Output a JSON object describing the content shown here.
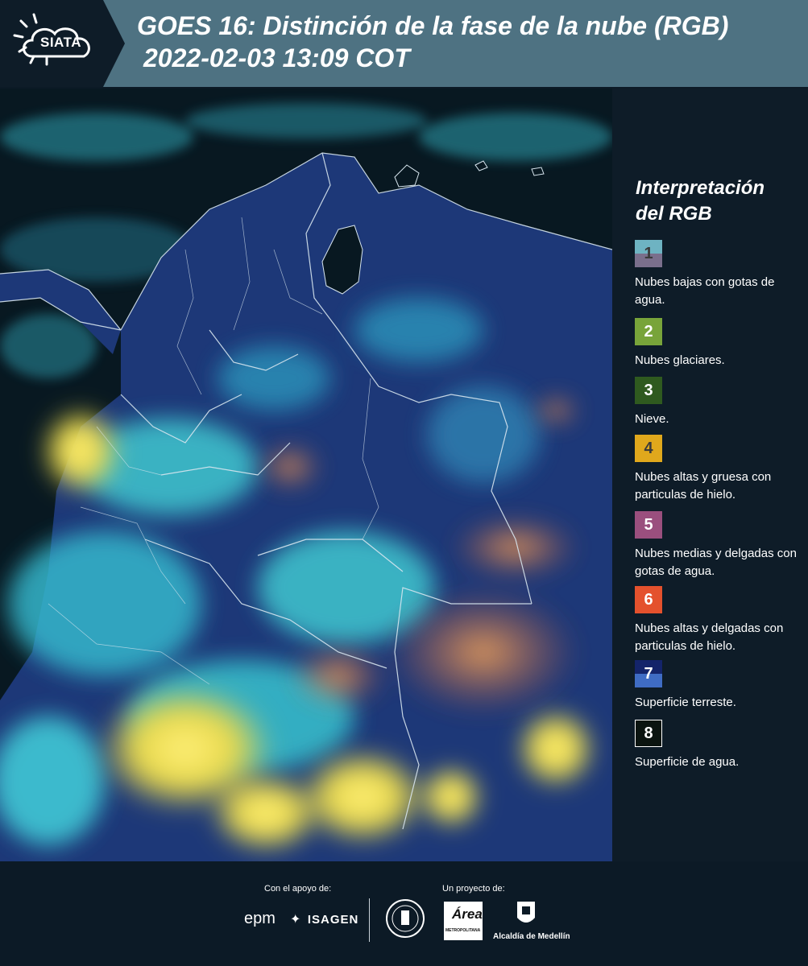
{
  "header": {
    "logo_text": "SIATA",
    "title_line1": "GOES 16: Distinción de la fase de la nube (RGB)",
    "title_line2": "2022-02-03 13:09 COT"
  },
  "legend": {
    "title": "Interpretación del RGB",
    "items": [
      {
        "num": "1",
        "color_top": "#6eb3c2",
        "color_bottom": "#7a6f8c",
        "text_color": "#3a3a3a",
        "label": "Nubes bajas con gotas de agua."
      },
      {
        "num": "2",
        "color_top": "#78a43a",
        "color_bottom": "#78a43a",
        "text_color": "#ffffff",
        "label": "Nubes glaciares."
      },
      {
        "num": "3",
        "color_top": "#2f5a1f",
        "color_bottom": "#2f5a1f",
        "text_color": "#ffffff",
        "label": "Nieve."
      },
      {
        "num": "4",
        "color_top": "#e0a81c",
        "color_bottom": "#e0a81c",
        "text_color": "#3a3a3a",
        "label": "Nubes altas y gruesa con particulas de hielo."
      },
      {
        "num": "5",
        "color_top": "#9a4f7e",
        "color_bottom": "#9a4f7e",
        "text_color": "#ffffff",
        "label": "Nubes medias y delgadas con gotas de agua."
      },
      {
        "num": "6",
        "color_top": "#e4512d",
        "color_bottom": "#e4512d",
        "text_color": "#ffffff",
        "label": "Nubes altas y delgadas con particulas de hielo."
      },
      {
        "num": "7",
        "color_top": "#14246a",
        "color_bottom": "#3f6cc4",
        "text_color": "#ffffff",
        "label": "Superficie terreste."
      },
      {
        "num": "8",
        "color_top": "#0b1410",
        "color_bottom": "#0b1410",
        "text_color": "#ffffff",
        "label": "Superficie de agua."
      }
    ]
  },
  "footer": {
    "support_label": "Con el apoyo de:",
    "project_label": "Un proyecto de:",
    "sponsor1": "epm",
    "sponsor2": "ISAGEN",
    "partner1": "Área",
    "partner1_sub": "METROPOLITANA",
    "partner2": "Alcaldía de Medellín"
  },
  "colors": {
    "header_bg": "#4e7282",
    "logo_bg": "#0e1c28",
    "legend_bg": "#0e1c28",
    "ocean": "#081821",
    "land": "#1e3b7e",
    "cloud_cyan": "#3fd1d6",
    "cloud_yellow": "#f2e052",
    "cloud_orange": "#e6874a"
  }
}
